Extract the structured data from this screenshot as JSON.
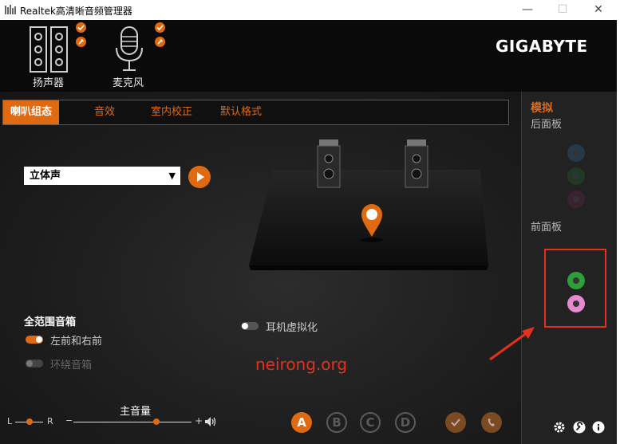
{
  "window": {
    "title": "Realtek高清晰音频管理器",
    "controls": {
      "minimize": "—",
      "maximize": "☐",
      "close": "✕"
    }
  },
  "header": {
    "devices": [
      {
        "label": "扬声器",
        "icon": "speaker-icon"
      },
      {
        "label": "麦克风",
        "icon": "microphone-icon"
      }
    ],
    "brand": "GIGABYTE"
  },
  "tabs": [
    {
      "label": "喇叭组态",
      "active": true
    },
    {
      "label": "音效",
      "active": false
    },
    {
      "label": "室内校正",
      "active": false
    },
    {
      "label": "默认格式",
      "active": false
    }
  ],
  "speaker_config": {
    "selected": "立体声",
    "headphone_virtualization_label": "耳机虚拟化",
    "headphone_virtualization_on": false
  },
  "fullrange": {
    "title": "全范围音箱",
    "options": [
      {
        "label": "左前和右前",
        "on": true
      },
      {
        "label": "环绕音箱",
        "on": false
      }
    ]
  },
  "volume": {
    "label": "主音量",
    "balance_left": "L",
    "balance_right": "R",
    "minus": "−",
    "plus": "+",
    "level_percent": 70,
    "balance_percent": 50
  },
  "profiles": [
    {
      "label": "A",
      "active": true
    },
    {
      "label": "B",
      "active": false
    },
    {
      "label": "C",
      "active": false
    },
    {
      "label": "D",
      "active": false
    }
  ],
  "sidebar": {
    "title": "模拟",
    "rear_panel": "后面板",
    "front_panel": "前面板",
    "colors": {
      "front_green": "#2e9e3a",
      "front_pink": "#e58ad0",
      "rear_blue": "#26394a",
      "rear_green": "#1f3a24",
      "rear_pink": "#3a2230"
    }
  },
  "watermark": "neirong.org",
  "accent": "#e06a10"
}
